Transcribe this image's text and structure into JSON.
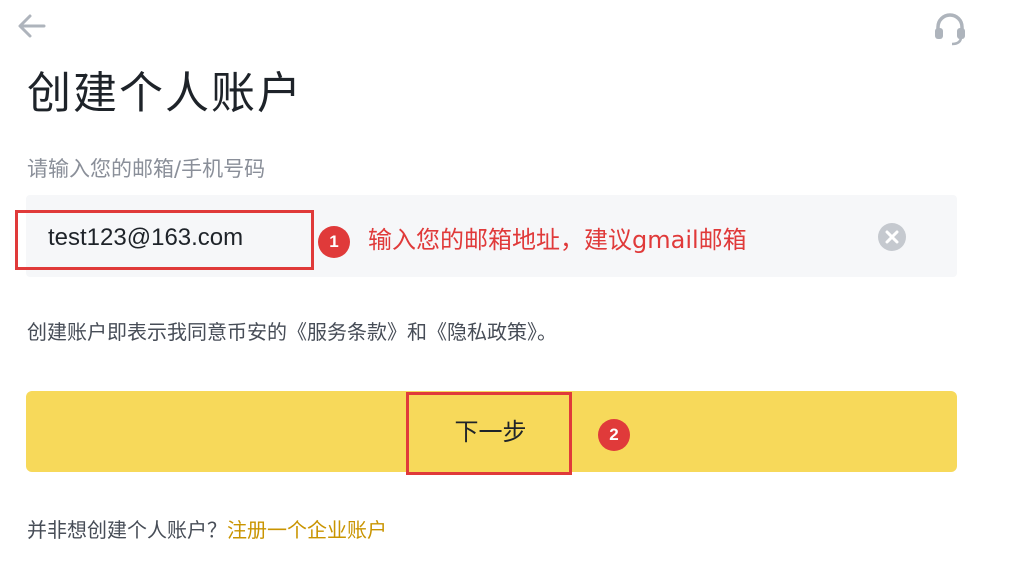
{
  "header": {
    "back_icon": "arrow-left-icon",
    "support_icon": "headset-icon"
  },
  "page": {
    "title": "创建个人账户"
  },
  "form": {
    "field_label": "请输入您的邮箱/手机号码",
    "input_value": "test123@163.com",
    "clear_icon": "clear-circle-icon"
  },
  "annotations": {
    "step1_number": "1",
    "step1_text": "输入您的邮箱地址，建议gmail邮箱",
    "step2_number": "2",
    "color": "#e03a3a"
  },
  "terms": {
    "text": "创建账户即表示我同意币安的《服务条款》和《隐私政策》。"
  },
  "actions": {
    "next_label": "下一步",
    "button_color": "#f7d95a"
  },
  "footer": {
    "prompt": "并非想创建个人账户？",
    "link": "注册一个企业账户",
    "link_color": "#c99400"
  }
}
